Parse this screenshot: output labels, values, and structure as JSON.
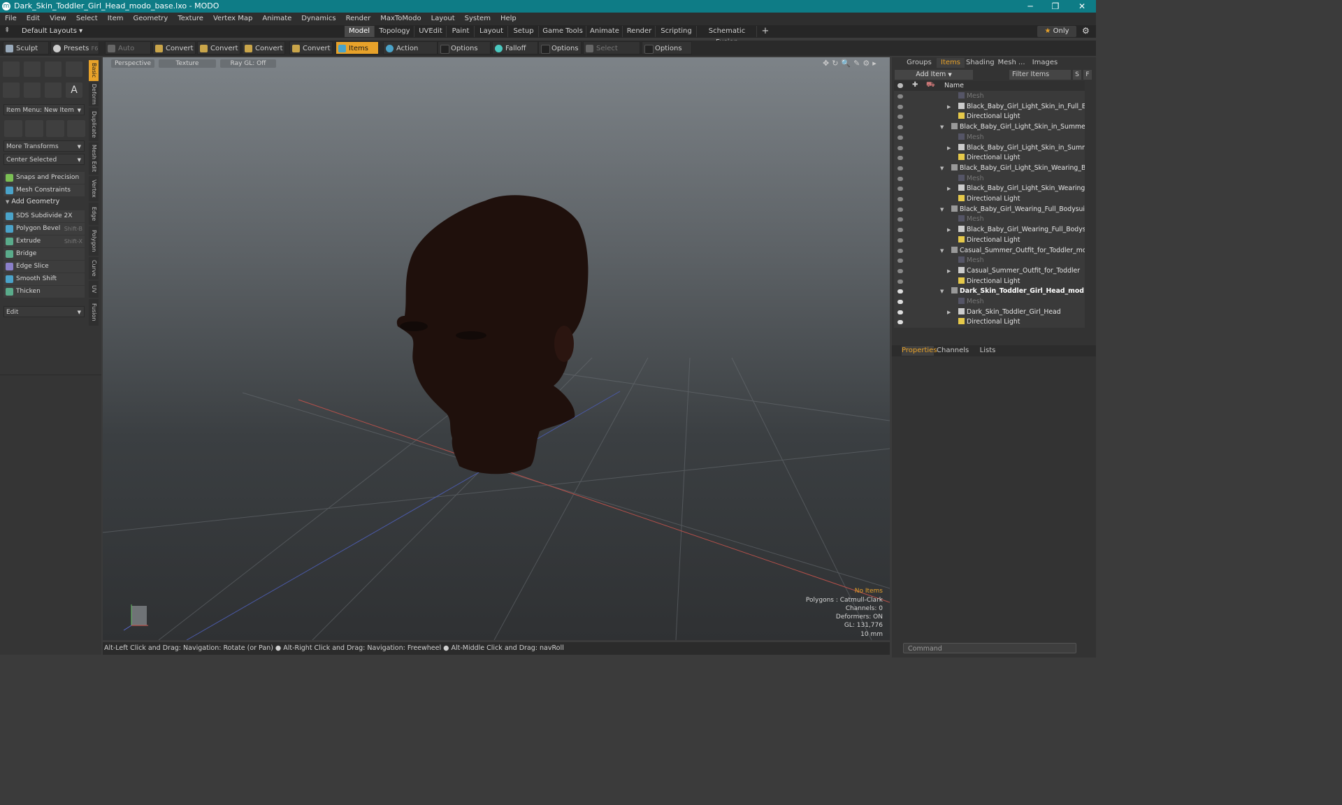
{
  "window": {
    "title": "Dark_Skin_Toddler_Girl_Head_modo_base.lxo - MODO",
    "minimize": "─",
    "maximize": "❐",
    "close": "✕"
  },
  "menu": [
    "File",
    "Edit",
    "View",
    "Select",
    "Item",
    "Geometry",
    "Texture",
    "Vertex Map",
    "Animate",
    "Dynamics",
    "Render",
    "MaxToModo",
    "Layout",
    "System",
    "Help"
  ],
  "layoutbar": {
    "layouts_label": "Default Layouts",
    "tabs": [
      "Model",
      "Topology",
      "UVEdit",
      "Paint",
      "Layout",
      "Setup",
      "Game Tools",
      "Animate",
      "Render",
      "Scripting",
      "Schematic Fusion"
    ],
    "add": "+",
    "only_label": "Only"
  },
  "toolbar": {
    "sculpt": "Sculpt",
    "presets": "Presets",
    "presets_shortcut": "F6",
    "auto_select": "Auto Select",
    "convert1": "Convert",
    "convert2": "Convert",
    "convert3": "Convert",
    "convert4": "Convert",
    "items": "Items",
    "action_center": "Action Center",
    "options1": "Options",
    "falloff": "Falloff",
    "options2": "Options",
    "select_through": "Select Through",
    "options3": "Options"
  },
  "leftpanel": {
    "item_menu": "Item Menu: New Item",
    "more_transforms": "More Transforms",
    "center_selected": "Center Selected",
    "snaps": "Snaps and Precision",
    "mesh_constraints": "Mesh Constraints",
    "add_geometry": "Add Geometry",
    "tools": [
      {
        "label": "SDS Subdivide 2X",
        "shortcut": ""
      },
      {
        "label": "Polygon Bevel",
        "shortcut": "Shift-B"
      },
      {
        "label": "Extrude",
        "shortcut": "Shift-X"
      },
      {
        "label": "Bridge",
        "shortcut": ""
      },
      {
        "label": "Edge Slice",
        "shortcut": ""
      },
      {
        "label": "Smooth Shift",
        "shortcut": ""
      },
      {
        "label": "Thicken",
        "shortcut": ""
      }
    ],
    "edit": "Edit",
    "vtabs": [
      "Basic",
      "Deform",
      "Duplicate",
      "Mesh Edit",
      "Vertex",
      "Edge",
      "Polygon",
      "Curve",
      "UV",
      "Fusion"
    ]
  },
  "viewport": {
    "tabs": [
      "Perspective",
      "Texture",
      "Ray GL: Off"
    ],
    "info": {
      "no_items": "No Items",
      "polygons": "Polygons : Catmull-Clark",
      "channels": "Channels: 0",
      "deformers": "Deformers: ON",
      "gl": "GL: 131,776",
      "scale": "10 mm"
    },
    "colors": {
      "no_items": "#e8a22a"
    }
  },
  "statusbar": "Alt-Left Click and Drag: Navigation: Rotate (or Pan) ● Alt-Right Click and Drag: Navigation: Freewheel ● Alt-Middle Click and Drag: navRoll",
  "rightpanel": {
    "tabs": [
      "Groups",
      "Items",
      "Shading",
      "Mesh ...",
      "Images"
    ],
    "add_item": "Add Item",
    "filter_items": "Filter Items",
    "s_btn": "S",
    "f_btn": "F",
    "name_header": "Name",
    "tree": [
      {
        "label": "Mesh",
        "kind": "mesh",
        "indent": 2
      },
      {
        "label": "Black_Baby_Girl_Light_Skin_in_Full_Body...",
        "kind": "item",
        "indent": 2,
        "expand": "▶"
      },
      {
        "label": "Directional Light",
        "kind": "light",
        "indent": 2
      },
      {
        "label": "Black_Baby_Girl_Light_Skin_in_Summer_A- ...",
        "kind": "scene",
        "indent": 1,
        "expand": "▼"
      },
      {
        "label": "Mesh",
        "kind": "mesh",
        "indent": 2
      },
      {
        "label": "Black_Baby_Girl_Light_Skin_in_Summer_...",
        "kind": "item",
        "indent": 2,
        "expand": "▶"
      },
      {
        "label": "Directional Light",
        "kind": "light",
        "indent": 2
      },
      {
        "label": "Black_Baby_Girl_Light_Skin_Wearing_Body ...",
        "kind": "scene",
        "indent": 1,
        "expand": "▼"
      },
      {
        "label": "Mesh",
        "kind": "mesh",
        "indent": 2
      },
      {
        "label": "Black_Baby_Girl_Light_Skin_Wearing_Bo ...",
        "kind": "item",
        "indent": 2,
        "expand": "▶"
      },
      {
        "label": "Directional Light",
        "kind": "light",
        "indent": 2
      },
      {
        "label": "Black_Baby_Girl_Wearing_Full_Bodysuit_A-...",
        "kind": "scene",
        "indent": 1,
        "expand": "▼"
      },
      {
        "label": "Mesh",
        "kind": "mesh",
        "indent": 2
      },
      {
        "label": "Black_Baby_Girl_Wearing_Full_Bodysuit ...",
        "kind": "item",
        "indent": 2,
        "expand": "▶"
      },
      {
        "label": "Directional Light",
        "kind": "light",
        "indent": 2
      },
      {
        "label": "Casual_Summer_Outfit_for_Toddler_modo ...",
        "kind": "scene",
        "indent": 1,
        "expand": "▼"
      },
      {
        "label": "Mesh",
        "kind": "mesh",
        "indent": 2
      },
      {
        "label": "Casual_Summer_Outfit_for_Toddler",
        "kind": "item",
        "indent": 2,
        "expand": "▶"
      },
      {
        "label": "Directional Light",
        "kind": "light",
        "indent": 2
      },
      {
        "label": "Dark_Skin_Toddler_Girl_Head_mod ...",
        "kind": "scene",
        "indent": 1,
        "expand": "▼",
        "bold": true
      },
      {
        "label": "Mesh",
        "kind": "mesh",
        "indent": 2
      },
      {
        "label": "Dark_Skin_Toddler_Girl_Head",
        "kind": "item",
        "indent": 2,
        "expand": "▶"
      },
      {
        "label": "Directional Light",
        "kind": "light",
        "indent": 2
      }
    ],
    "bottom_tabs": [
      "Properties",
      "Channels",
      "Lists"
    ],
    "command_placeholder": "Command"
  },
  "colors": {
    "accent": "#e8a22a",
    "titlebar": "#0e7c86"
  }
}
